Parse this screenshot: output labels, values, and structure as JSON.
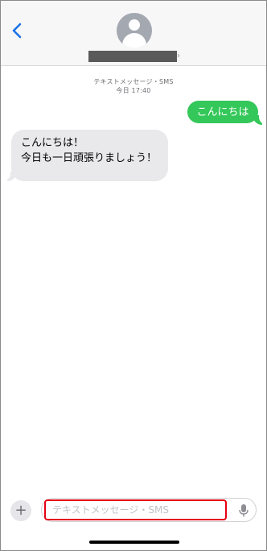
{
  "header": {
    "back_icon": "chevron-left-icon",
    "avatar_icon": "person-avatar-icon",
    "detail_icon": "chevron-right-icon"
  },
  "conversation": {
    "service_label": "テキストメッセージ・SMS",
    "timestamp": "今日 17:40",
    "messages": [
      {
        "direction": "outgoing",
        "text": "こんにちは"
      },
      {
        "direction": "incoming",
        "text": "こんにちは！\n今日も一日頑張りましょう！"
      }
    ]
  },
  "composer": {
    "plus_label": "+",
    "input_value": "",
    "input_placeholder": "テキストメッセージ・SMS",
    "mic_icon": "microphone-icon"
  },
  "colors": {
    "accent_blue": "#1a73e8",
    "outgoing_bubble": "#34c759",
    "incoming_bubble": "#e9e9eb",
    "highlight_border": "#e50012"
  }
}
